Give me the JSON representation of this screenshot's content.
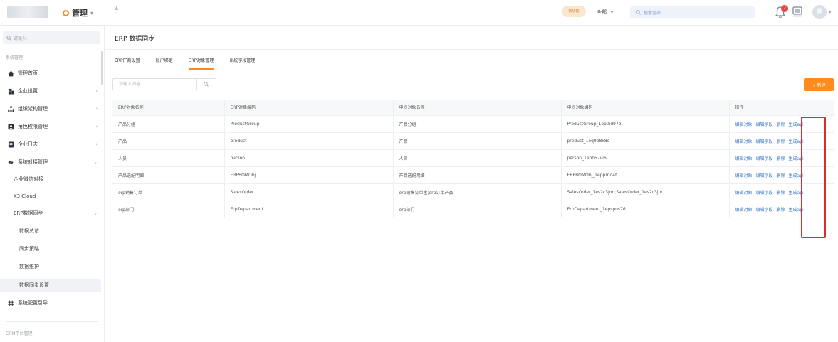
{
  "header": {
    "app_switcher_label": "管理",
    "promo_badge": "新功能",
    "search_scope": "全部",
    "search_placeholder": "搜索全部",
    "notification_count": "2"
  },
  "sidebar": {
    "search_placeholder": "请输入",
    "section_label": "系统管理",
    "items": [
      {
        "label": "管理首页",
        "icon": "home-icon"
      },
      {
        "label": "企业设置",
        "icon": "building-icon"
      },
      {
        "label": "组织架构管理",
        "icon": "org-chart-icon"
      },
      {
        "label": "角色权限管理",
        "icon": "role-icon"
      },
      {
        "label": "企业日志",
        "icon": "log-icon"
      },
      {
        "label": "系统对接管理",
        "icon": "link-icon"
      }
    ],
    "sub_items": [
      "企业微信对接",
      "K3 Cloud",
      "ERP数据同步"
    ],
    "erp_children": [
      "数据总览",
      "同步策略",
      "数据维护",
      "数据同步设置"
    ],
    "config_guide": "系统配置引导",
    "bottom_section": "CRM平台管理"
  },
  "main": {
    "page_title": "ERP 数据同步",
    "tabs": [
      "ERP厂商设置",
      "账户绑定",
      "ERP对象管理",
      "系统字段管理"
    ],
    "active_tab": 2,
    "filter_placeholder": "请输入内容",
    "new_button": "+ 新建",
    "columns": [
      "ERP对象名称",
      "ERP对象编码",
      "中间对象名称",
      "中间对象编码",
      "操作"
    ],
    "rows": [
      [
        "产品分组",
        "ProductGroup",
        "产品分组",
        "ProductGroup_1ep0id97o"
      ],
      [
        "产品",
        "product",
        "产品",
        "product_1eq9b8k8e"
      ],
      [
        "人员",
        "person",
        "人员",
        "person_1eoh57vi6"
      ],
      [
        "产品选配明细",
        "ERPBOMObj",
        "产品选配明细",
        "ERPBOMObj_1epprnq4t"
      ],
      [
        "erp销售订单",
        "SalesOrder",
        "erp销售订单主;erp订单产品",
        "SalesOrder_1es2c3jon;SalesOrder_1es2c3jpc"
      ],
      [
        "erp部门",
        "ErpDepartment",
        "erp部门",
        "ErpDepartment_1epspus76"
      ]
    ],
    "actions": [
      "编辑对象",
      "编辑字段",
      "删除",
      "生成api"
    ]
  },
  "colors": {
    "accent": "#ff8a1d",
    "link": "#3d78c9",
    "highlight": "#d92d2d"
  }
}
